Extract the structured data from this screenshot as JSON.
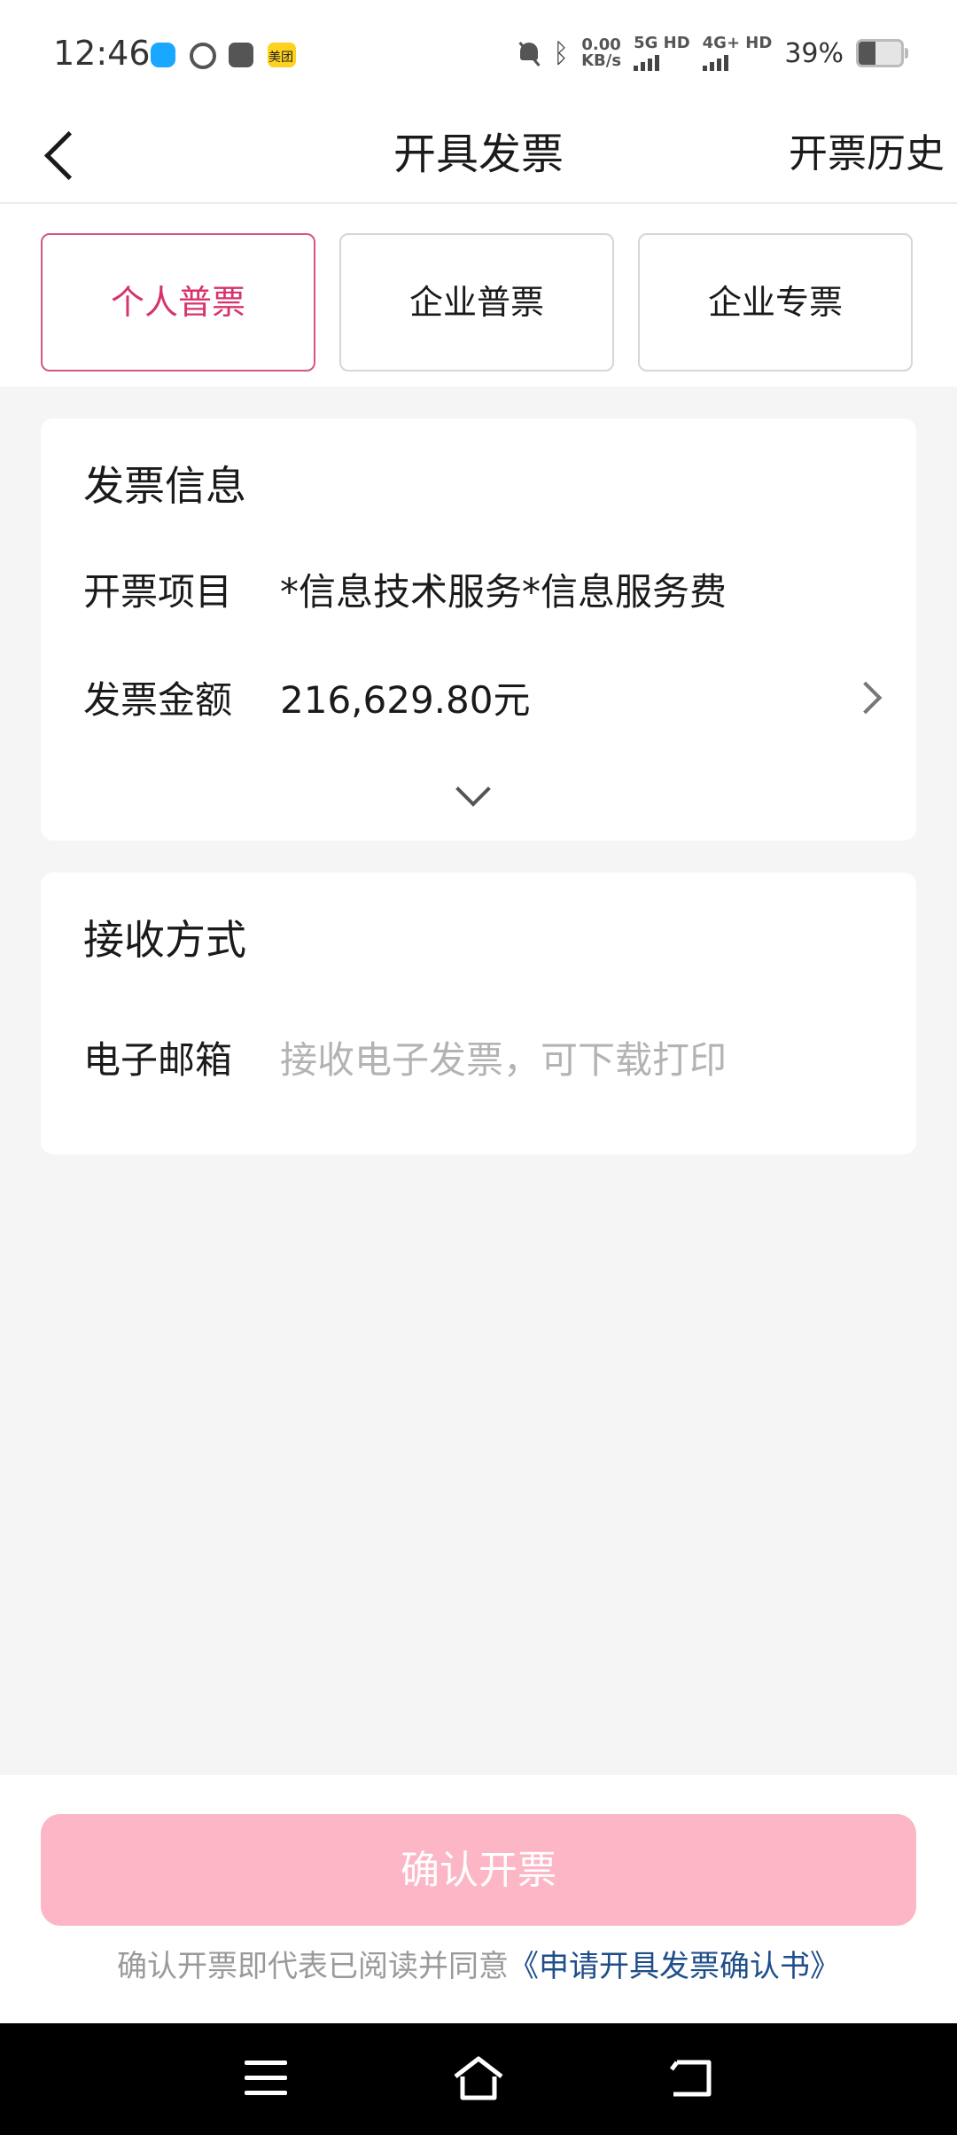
{
  "status_bar": {
    "time": "12:46",
    "app_badge": "美团",
    "net_speed_value": "0.00",
    "net_speed_unit": "KB/s",
    "sim1": "5G HD",
    "sim2": "4G+ HD",
    "battery_percent": 39,
    "battery_text": "39%"
  },
  "header": {
    "title": "开具发票",
    "history_label": "开票历史"
  },
  "invoice_types": [
    {
      "label": "个人普票",
      "selected": true
    },
    {
      "label": "企业普票",
      "selected": false
    },
    {
      "label": "企业专票",
      "selected": false
    }
  ],
  "invoice_info": {
    "title": "发票信息",
    "item_label": "开票项目",
    "item_value": "*信息技术服务*信息服务费",
    "amount_label": "发票金额",
    "amount_value": "216,629.80元"
  },
  "receive": {
    "title": "接收方式",
    "email_label": "电子邮箱",
    "email_placeholder": "接收电子发票，可下载打印"
  },
  "footer": {
    "confirm_label": "确认开票",
    "agree_text": "确认开票即代表已阅读并同意",
    "agree_link": "《申请开具发票确认书》"
  },
  "colors": {
    "accent": "#d6336c",
    "confirm_bg": "#fdb6c5",
    "link": "#1f4e8a",
    "page_bg": "#f5f5f5"
  }
}
